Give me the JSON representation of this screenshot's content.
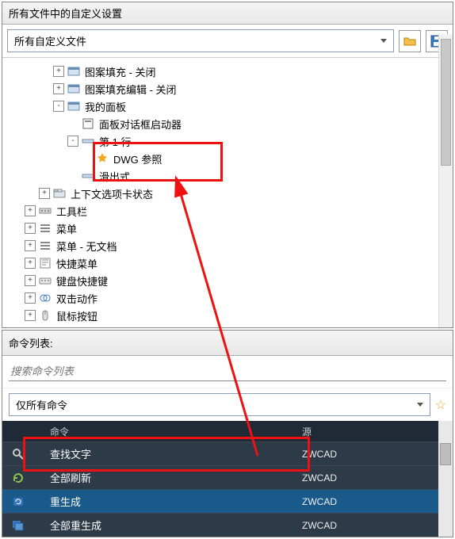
{
  "topPanel": {
    "title": "所有文件中的自定义设置",
    "dropdown": "所有自定义文件",
    "tree": [
      {
        "indent": 3,
        "exp": "+",
        "icon": "panel",
        "label": "图案填充 - 关闭"
      },
      {
        "indent": 3,
        "exp": "+",
        "icon": "panel",
        "label": "图案填充编辑 - 关闭"
      },
      {
        "indent": 3,
        "exp": "-",
        "icon": "panel",
        "label": "我的面板"
      },
      {
        "indent": 4,
        "exp": "",
        "icon": "dialog",
        "label": "面板对话框启动器"
      },
      {
        "indent": 4,
        "exp": "-",
        "icon": "row",
        "label": "第 1 行"
      },
      {
        "indent": 5,
        "exp": "",
        "icon": "star",
        "label": "DWG 参照"
      },
      {
        "indent": 4,
        "exp": "",
        "icon": "row",
        "label": "滑出式"
      },
      {
        "indent": 2,
        "exp": "+",
        "icon": "tabs",
        "label": "上下文选项卡状态"
      },
      {
        "indent": 1,
        "exp": "+",
        "icon": "toolbar",
        "label": "工具栏"
      },
      {
        "indent": 1,
        "exp": "+",
        "icon": "menu",
        "label": "菜单"
      },
      {
        "indent": 1,
        "exp": "+",
        "icon": "menu",
        "label": "菜单 - 无文档"
      },
      {
        "indent": 1,
        "exp": "+",
        "icon": "shortcut",
        "label": "快捷菜单"
      },
      {
        "indent": 1,
        "exp": "+",
        "icon": "keyboard",
        "label": "键盘快捷键"
      },
      {
        "indent": 1,
        "exp": "+",
        "icon": "dblclick",
        "label": "双击动作"
      },
      {
        "indent": 1,
        "exp": "+",
        "icon": "mouse",
        "label": "鼠标按钮"
      }
    ]
  },
  "cmdPanel": {
    "title": "命令列表:",
    "searchPlaceholder": "搜索命令列表",
    "filter": "仅所有命令",
    "headers": {
      "c2": "命令",
      "c3": "源"
    },
    "rows": [
      {
        "icon": "find",
        "name": "查找文字",
        "src": "ZWCAD",
        "sel": false
      },
      {
        "icon": "refresh",
        "name": "全部刷新",
        "src": "ZWCAD",
        "sel": false
      },
      {
        "icon": "regen",
        "name": "重生成",
        "src": "ZWCAD",
        "sel": true
      },
      {
        "icon": "regenall",
        "name": "全部重生成",
        "src": "ZWCAD",
        "sel": false
      }
    ]
  }
}
